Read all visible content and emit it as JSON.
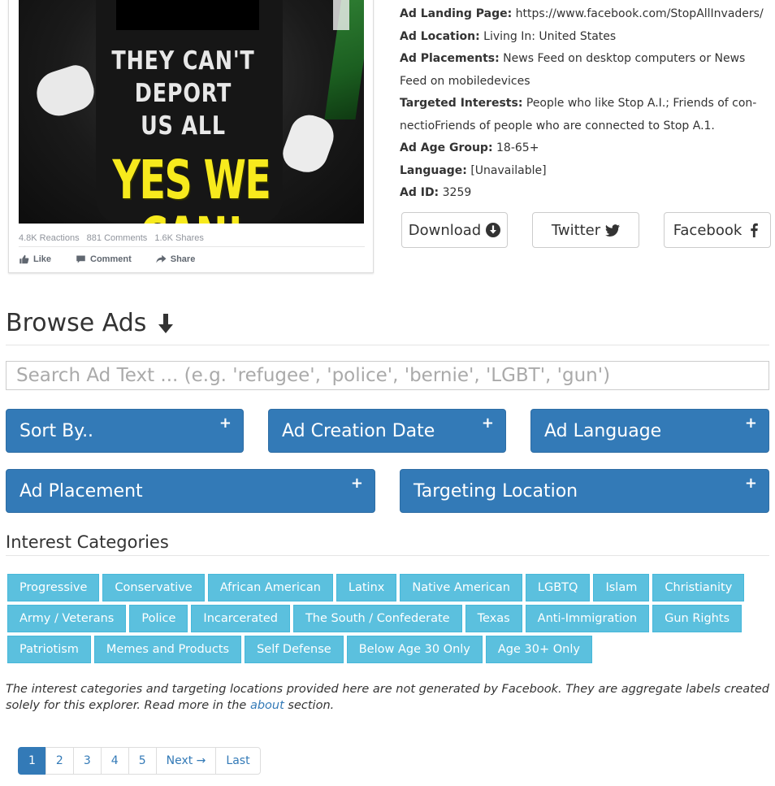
{
  "ad_card": {
    "image_slogan_line1": "THEY CAN'T",
    "image_slogan_line2": "DEPORT",
    "image_slogan_line3": "US ALL",
    "image_slogan_big": "YES WE CAN!",
    "reactions": "4.8K Reactions",
    "comments": "881 Comments",
    "shares": "1.6K Shares",
    "like_label": "Like",
    "comment_label": "Comment",
    "share_label": "Share"
  },
  "details": {
    "landing_page_label": "Ad Landing Page:",
    "landing_page_value": "https://www.facebook.com/StopAllInvaders/",
    "location_label": "Ad Location:",
    "location_value": "Living In: United States",
    "placements_label": "Ad Placements:",
    "placements_value": "News Feed on desktop computers or News Feed on mobiledevices",
    "interests_label": "Targeted Interests:",
    "interests_value": "People who like Stop A.I.; Friends of con-nectioFriends of people who are connected to Stop A.1.",
    "age_label": "Ad Age Group:",
    "age_value": "18-65+",
    "language_label": "Language:",
    "language_value": "[Unavailable]",
    "id_label": "Ad ID:",
    "id_value": "3259"
  },
  "share_buttons": {
    "download": "Download",
    "twitter": "Twitter",
    "facebook": "Facebook"
  },
  "browse": {
    "title": "Browse Ads",
    "search_placeholder": "Search Ad Text ... (e.g. 'refugee', 'police', 'bernie', 'LGBT', 'gun')"
  },
  "filters": {
    "sort_by": "Sort By..",
    "creation_date": "Ad Creation Date",
    "language": "Ad Language",
    "placement": "Ad Placement",
    "targeting_location": "Targeting Location",
    "plus": "+"
  },
  "interest_categories": {
    "title": "Interest Categories",
    "row1": [
      "Progressive",
      "Conservative",
      "African American",
      "Latinx",
      "Native American",
      "LGBTQ",
      "Islam",
      "Christianity"
    ],
    "row2": [
      "Army / Veterans",
      "Police",
      "Incarcerated",
      "The South / Confederate",
      "Texas",
      "Anti-Immigration",
      "Gun Rights"
    ],
    "row3": [
      "Patriotism",
      "Memes and Products",
      "Self Defense",
      "Below Age 30 Only",
      "Age 30+ Only"
    ]
  },
  "note": {
    "text_before": "The interest categories and targeting locations provided here are not generated by Facebook. They are aggregate labels created solely for this explorer. Read more in the ",
    "link": "about",
    "text_after": " section."
  },
  "pagination": {
    "pages": [
      "1",
      "2",
      "3",
      "4",
      "5"
    ],
    "next": "Next →",
    "last": "Last",
    "active_page": "1"
  },
  "colors": {
    "primary": "#337ab7",
    "tag": "#5bc0de",
    "slogan_yellow": "#f7ea1d"
  }
}
